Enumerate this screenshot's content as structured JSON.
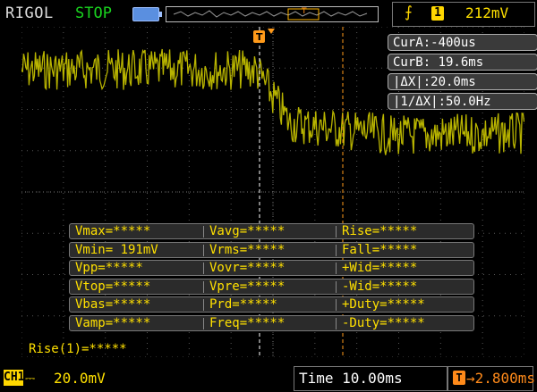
{
  "header": {
    "brand": "RIGOL",
    "run_state": "STOP",
    "trigger_slope_symbol": "⨍",
    "trigger_channel": "1",
    "trigger_level": "212mV"
  },
  "cursors": {
    "cur_a": "CurA:-400us",
    "cur_b": "CurB: 19.6ms",
    "delta_x": "|ΔX|:20.0ms",
    "inv_delta_x": "|1/ΔX|:50.0Hz"
  },
  "measurements": {
    "rows": [
      [
        "Vmax=*****",
        "Vavg=*****",
        "Rise=*****"
      ],
      [
        "Vmin= 191mV",
        "Vrms=*****",
        "Fall=*****"
      ],
      [
        "Vpp=*****",
        "Vovr=*****",
        "+Wid=*****"
      ],
      [
        "Vtop=*****",
        "Vpre=*****",
        "-Wid=*****"
      ],
      [
        "Vbas=*****",
        "Prd=*****",
        "+Duty=*****"
      ],
      [
        "Vamp=*****",
        "Freq=*****",
        "-Duty=*****"
      ]
    ],
    "rise1": "Rise(1)=*****"
  },
  "footer": {
    "ch1_label": "CH1",
    "ch1_coupling": "⎓",
    "ch1_scale": "20.0mV",
    "timebase": "Time 10.00ms",
    "offset_icon": "T",
    "offset_value": "→2.800ms"
  },
  "colors": {
    "trace": "#b8b400",
    "channel": "#ffe000",
    "cursor_b": "#ff9a1a",
    "run_state": "#19d31f"
  }
}
